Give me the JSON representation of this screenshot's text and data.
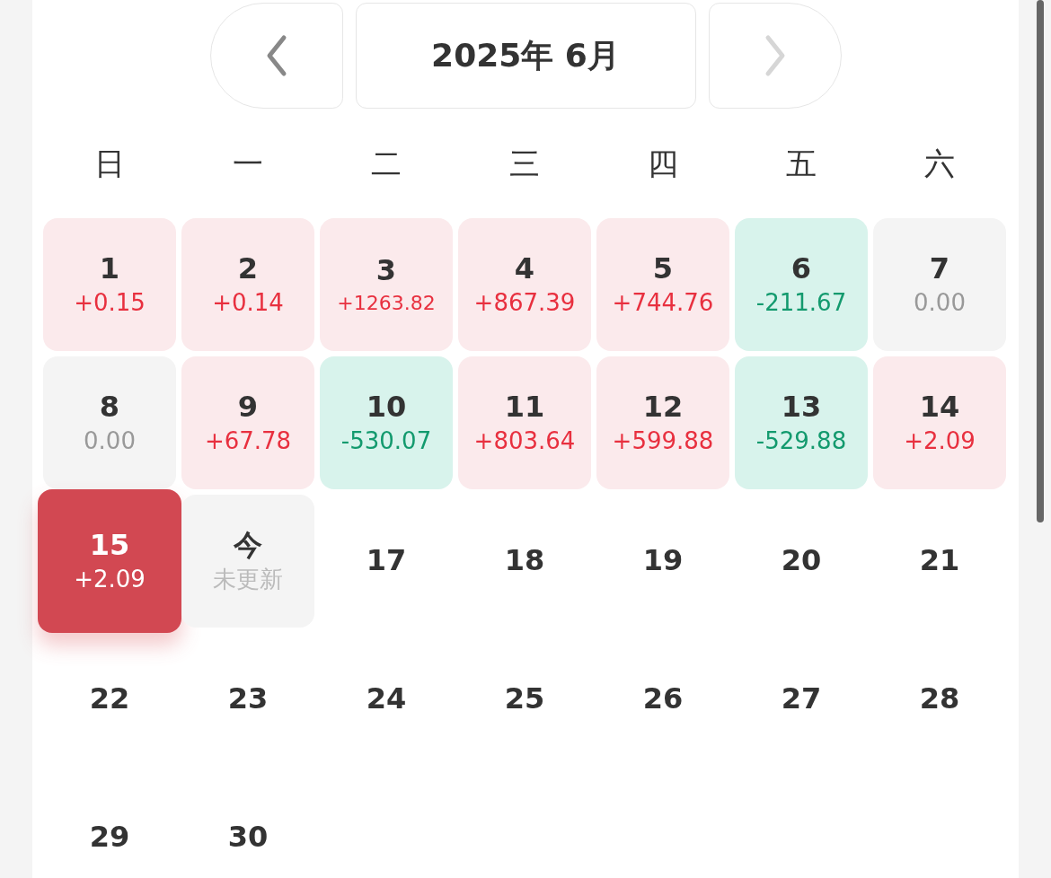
{
  "header": {
    "prev": {
      "disabled": false
    },
    "month": "2025年 6月",
    "next": {
      "disabled": true
    }
  },
  "weekdays": [
    "日",
    "一",
    "二",
    "三",
    "四",
    "五",
    "六"
  ],
  "days": [
    {
      "day": "1",
      "value": "+0.15",
      "kind": "gain",
      "selected": false
    },
    {
      "day": "2",
      "value": "+0.14",
      "kind": "gain",
      "selected": false
    },
    {
      "day": "3",
      "value": "+1263.82",
      "kind": "gain",
      "selected": false
    },
    {
      "day": "4",
      "value": "+867.39",
      "kind": "gain",
      "selected": false
    },
    {
      "day": "5",
      "value": "+744.76",
      "kind": "gain",
      "selected": false
    },
    {
      "day": "6",
      "value": "-211.67",
      "kind": "loss",
      "selected": false
    },
    {
      "day": "7",
      "value": "0.00",
      "kind": "flat",
      "selected": false
    },
    {
      "day": "8",
      "value": "0.00",
      "kind": "flat",
      "selected": false
    },
    {
      "day": "9",
      "value": "+67.78",
      "kind": "gain",
      "selected": false
    },
    {
      "day": "10",
      "value": "-530.07",
      "kind": "loss",
      "selected": false
    },
    {
      "day": "11",
      "value": "+803.64",
      "kind": "gain",
      "selected": false
    },
    {
      "day": "12",
      "value": "+599.88",
      "kind": "gain",
      "selected": false
    },
    {
      "day": "13",
      "value": "-529.88",
      "kind": "loss",
      "selected": false
    },
    {
      "day": "14",
      "value": "+2.09",
      "kind": "gain",
      "selected": false
    },
    {
      "day": "15",
      "value": "+2.09",
      "kind": "gain",
      "selected": true
    },
    {
      "day": "今",
      "value": "未更新",
      "kind": "pending",
      "selected": false
    },
    {
      "day": "17",
      "kind": "future",
      "selected": false
    },
    {
      "day": "18",
      "kind": "future",
      "selected": false
    },
    {
      "day": "19",
      "kind": "future",
      "selected": false
    },
    {
      "day": "20",
      "kind": "future",
      "selected": false
    },
    {
      "day": "21",
      "kind": "future",
      "selected": false
    },
    {
      "day": "22",
      "kind": "future",
      "selected": false
    },
    {
      "day": "23",
      "kind": "future",
      "selected": false
    },
    {
      "day": "24",
      "kind": "future",
      "selected": false
    },
    {
      "day": "25",
      "kind": "future",
      "selected": false
    },
    {
      "day": "26",
      "kind": "future",
      "selected": false
    },
    {
      "day": "27",
      "kind": "future",
      "selected": false
    },
    {
      "day": "28",
      "kind": "future",
      "selected": false
    },
    {
      "day": "29",
      "kind": "future",
      "selected": false
    },
    {
      "day": "30",
      "kind": "future",
      "selected": false
    }
  ]
}
